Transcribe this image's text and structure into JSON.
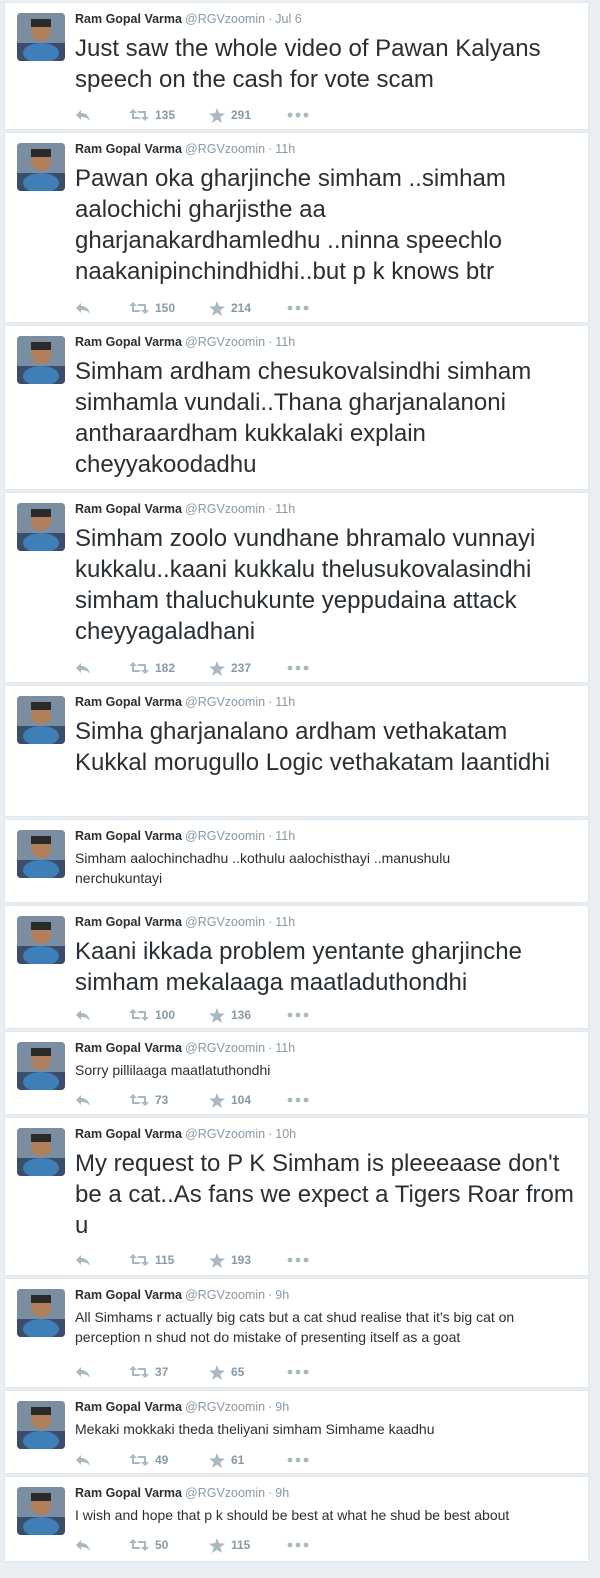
{
  "author": {
    "name": "Ram Gopal Varma",
    "handle": "@RGVzoomin"
  },
  "tweets": [
    {
      "time": "Jul 6",
      "text": "Just saw the whole video of Pawan Kalyans speech on the cash for vote scam",
      "retweets": "135",
      "favorites": "291"
    },
    {
      "time": "11h",
      "text": "Pawan oka gharjinche simham ..simham aalochichi gharjisthe aa gharjanakardhamledhu ..ninna speechlo naakanipinchindhidhi..but p k knows btr",
      "retweets": "150",
      "favorites": "214"
    },
    {
      "time": "11h",
      "text": "Simham ardham chesukovalsindhi simham simhamla vundali..Thana gharjanalanoni antharaardham  kukkalaki explain cheyyakoodadhu",
      "retweets": "",
      "favorites": ""
    },
    {
      "time": "11h",
      "text": "Simham zoolo vundhane bhramalo vunnayi kukkalu..kaani kukkalu thelusukovalasindhi simham thaluchukunte yeppudaina attack cheyyagaladhani",
      "retweets": "182",
      "favorites": "237"
    },
    {
      "time": "11h",
      "text": "Simha gharjanalano ardham vethakatam Kukkal morugullo Logic vethakatam laantidhi",
      "retweets": "",
      "favorites": ""
    },
    {
      "time": "11h",
      "text": "Simham aalochinchadhu ..kothulu aalochisthayi ..manushulu nerchukuntayi",
      "retweets": "",
      "favorites": ""
    },
    {
      "time": "11h",
      "text": "Kaani ikkada problem yentante gharjinche simham mekalaaga maatladuthondhi",
      "retweets": "100",
      "favorites": "136"
    },
    {
      "time": "11h",
      "text": "Sorry pillilaaga maatlatuthondhi",
      "retweets": "73",
      "favorites": "104"
    },
    {
      "time": "10h",
      "text": "My request to P K Simham is pleeeaase don't be a cat..As fans we expect a Tigers Roar from u",
      "retweets": "115",
      "favorites": "193"
    },
    {
      "time": "9h",
      "text": "All Simhams r actually big cats but a cat shud  realise that it's big cat on perception n shud not do mistake of presenting itself as a goat",
      "retweets": "37",
      "favorites": "65"
    },
    {
      "time": "9h",
      "text": "Mekaki mokkaki theda theliyani simham Simhame kaadhu",
      "retweets": "49",
      "favorites": "61"
    },
    {
      "time": "9h",
      "text": "I wish and hope that p k should be best at what he shud be best about",
      "retweets": "50",
      "favorites": "115"
    }
  ],
  "icons": {
    "reply": "reply-icon",
    "retweet": "retweet-icon",
    "favorite": "star-icon",
    "more": "more-icon"
  },
  "colors": {
    "muted": "#8899a6",
    "text": "#292f33",
    "border": "#e1e8ed"
  }
}
